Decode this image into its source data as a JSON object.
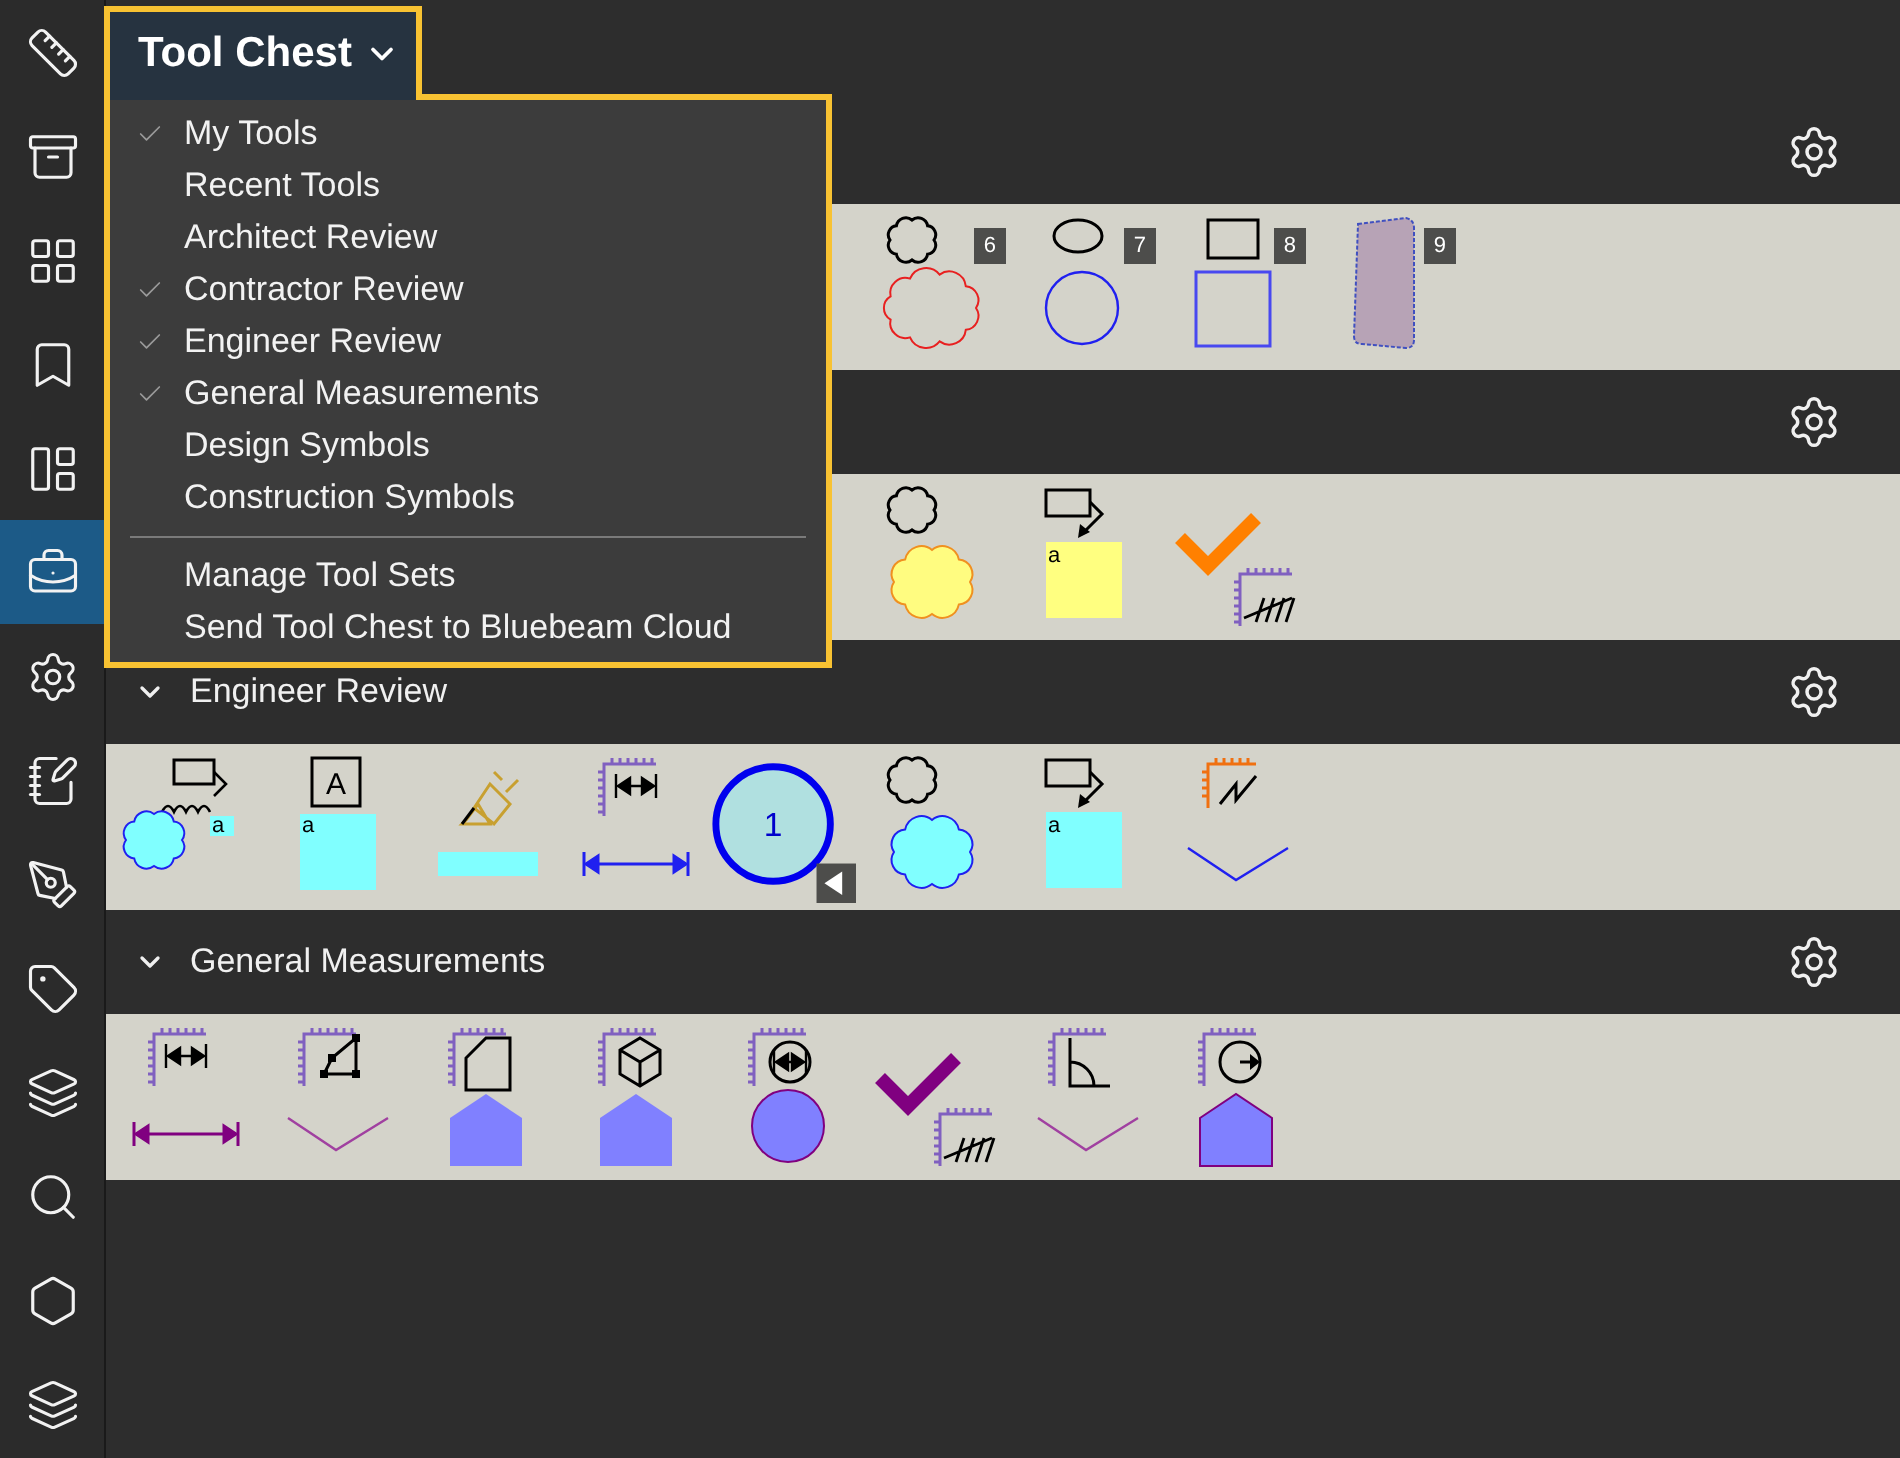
{
  "sidebar": {
    "items": [
      {
        "selected": false
      },
      {
        "selected": false
      },
      {
        "selected": false
      },
      {
        "selected": false
      },
      {
        "selected": false
      },
      {
        "selected": true
      },
      {
        "selected": false
      },
      {
        "selected": false
      },
      {
        "selected": false
      },
      {
        "selected": false
      },
      {
        "selected": false
      },
      {
        "selected": false
      },
      {
        "selected": false
      },
      {
        "selected": false
      }
    ]
  },
  "tool_chest": {
    "title": "Tool Chest",
    "expanded": true,
    "tool_sets": [
      {
        "label": "My Tools",
        "checked": true
      },
      {
        "label": "Recent Tools",
        "checked": false
      },
      {
        "label": "Architect Review",
        "checked": false
      },
      {
        "label": "Contractor Review",
        "checked": true
      },
      {
        "label": "Engineer Review",
        "checked": true
      },
      {
        "label": "General Measurements",
        "checked": true
      },
      {
        "label": "Design Symbols",
        "checked": false
      },
      {
        "label": "Construction Symbols",
        "checked": false
      }
    ],
    "actions": [
      "Manage Tool Sets",
      "Send Tool Chest to Bluebeam Cloud"
    ]
  },
  "sections": [
    {
      "tools": [
        {
          "kind": "cloud-red",
          "badge": "6"
        },
        {
          "kind": "ellipse",
          "badge": "7"
        },
        {
          "kind": "rectangle",
          "badge": "8"
        },
        {
          "kind": "polygon",
          "badge": "9"
        }
      ]
    },
    {
      "tools": [
        {
          "kind": "cloud-yellow"
        },
        {
          "kind": "callout-yellow",
          "label": "a"
        },
        {
          "kind": "count-orange"
        }
      ]
    },
    {
      "title": "Engineer Review",
      "expanded": true,
      "tools": [
        {
          "kind": "cloud-callout",
          "label": "a"
        },
        {
          "kind": "text-box",
          "label": "A",
          "sublabel": "a"
        },
        {
          "kind": "highlight"
        },
        {
          "kind": "dimension"
        },
        {
          "kind": "number-circle",
          "label": "1"
        },
        {
          "kind": "cloud-cyan"
        },
        {
          "kind": "callout-cyan",
          "label": "a"
        },
        {
          "kind": "polyline-blue"
        }
      ]
    },
    {
      "title": "General Measurements",
      "expanded": true,
      "tools": [
        {
          "kind": "length"
        },
        {
          "kind": "perimeter"
        },
        {
          "kind": "area"
        },
        {
          "kind": "volume"
        },
        {
          "kind": "diameter"
        },
        {
          "kind": "count-purple"
        },
        {
          "kind": "angle"
        },
        {
          "kind": "radius"
        }
      ]
    }
  ]
}
